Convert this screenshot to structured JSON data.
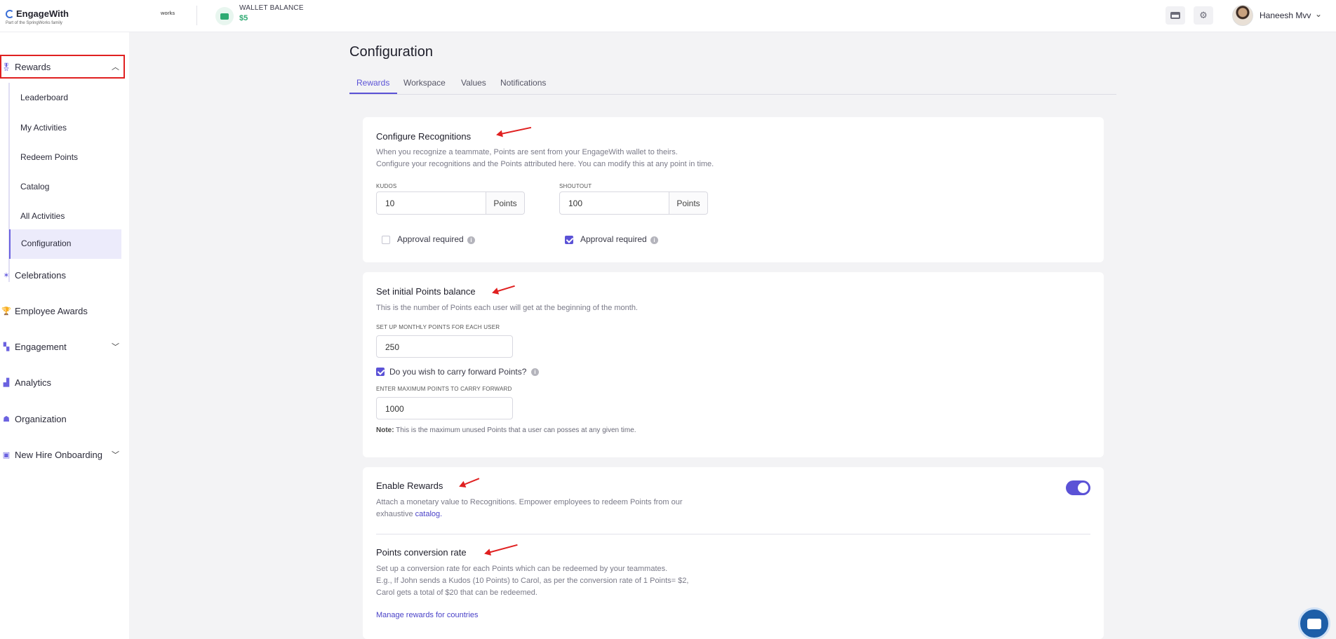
{
  "brand": {
    "name": "EngageWith",
    "tagline": "Part of the SpringWorks family",
    "partner": "works"
  },
  "wallet": {
    "label": "WALLET BALANCE",
    "value": "$5"
  },
  "header": {
    "user_name": "Haneesh Mvv",
    "icons": [
      "card-icon",
      "gear-icon",
      "chevron-down-icon"
    ]
  },
  "sidebar": {
    "rewards": "Rewards",
    "children": [
      "Leaderboard",
      "My Activities",
      "Redeem Points",
      "Catalog",
      "All Activities",
      "Configuration"
    ],
    "items": [
      "Celebrations",
      "Employee Awards",
      "Engagement",
      "Analytics",
      "Organization",
      "New Hire Onboarding"
    ]
  },
  "page": {
    "title": "Configuration",
    "tabs": [
      "Rewards",
      "Workspace",
      "Values",
      "Notifications"
    ],
    "active_tab": "Rewards"
  },
  "recognitions": {
    "title": "Configure Recognitions",
    "desc1": "When you recognize a teammate, Points are sent from your EngageWith wallet to theirs.",
    "desc2": "Configure your recognitions and the Points attributed here. You can modify this at any point in time.",
    "kudos": {
      "label": "KUDOS",
      "value": "10",
      "unit": "Points",
      "approval_label": "Approval required",
      "approval_checked": false
    },
    "shoutout": {
      "label": "SHOUTOUT",
      "value": "100",
      "unit": "Points",
      "approval_label": "Approval required",
      "approval_checked": true
    }
  },
  "initial_balance": {
    "title": "Set initial Points balance",
    "desc": "This is the number of Points each user will get at the beginning of the month.",
    "monthly_label": "SET UP MONTHLY POINTS FOR EACH USER",
    "monthly_value": "250",
    "carry_label": "Do you wish to carry forward Points?",
    "carry_checked": true,
    "max_label": "ENTER MAXIMUM POINTS TO CARRY FORWARD",
    "max_value": "1000",
    "note_prefix": "Note:",
    "note_text": "This is the maximum unused Points that a user can posses at any given time."
  },
  "enable_rewards": {
    "title": "Enable Rewards",
    "desc1": "Attach a monetary value to Recognitions. Empower employees to redeem Points from our",
    "desc2_prefix": "exhaustive",
    "desc2_link": "catalog.",
    "enabled": true
  },
  "conversion": {
    "title": "Points conversion rate",
    "line1": "Set up a conversion rate for each Points which can be redeemed by your teammates.",
    "line2": "E.g., If John sends a Kudos (10 Points) to Carol, as per the conversion rate of 1 Points= $2,",
    "line3": "Carol gets a total of $20 that can be redeemed.",
    "manage_link": "Manage rewards for countries"
  }
}
